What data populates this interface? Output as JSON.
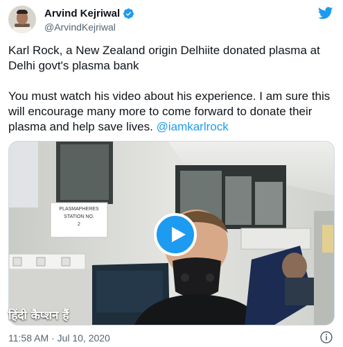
{
  "author": {
    "display_name": "Arvind Kejriwal",
    "handle": "@ArvindKejriwal",
    "verified": true
  },
  "tweet": {
    "paragraph_1": "Karl Rock, a New Zealand origin Delhiite donated plasma at Delhi govt's plasma bank",
    "paragraph_2": "You must watch his video about his experience. I am sure this will encourage many more to come forward to donate their plasma and help save lives.",
    "mention": "@iamkarlrock"
  },
  "media": {
    "type": "video",
    "sign_text": "PLASMAPHERES STATION NO. 2",
    "sign_line_1": "PLASMAPHERES",
    "sign_line_2": "STATION NO.",
    "sign_line_3": "2",
    "caption": "हिंदी कैप्शन हैं"
  },
  "meta": {
    "timestamp": "11:58 AM · Jul 10, 2020"
  },
  "colors": {
    "accent": "#1d9bf0",
    "text": "#0f1419",
    "secondary_text": "#536471"
  },
  "icons": [
    "verified-badge-icon",
    "twitter-bird-icon",
    "play-icon",
    "info-icon"
  ]
}
